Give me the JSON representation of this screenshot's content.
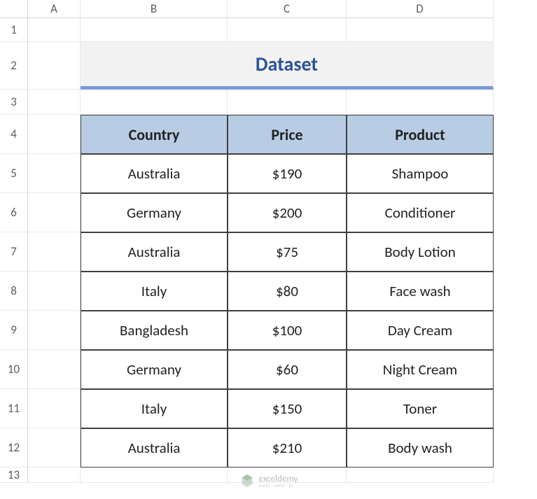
{
  "columns": [
    "A",
    "B",
    "C",
    "D"
  ],
  "rows": [
    "1",
    "2",
    "3",
    "4",
    "5",
    "6",
    "7",
    "8",
    "9",
    "10",
    "11",
    "12",
    "13"
  ],
  "title": "Dataset",
  "headers": {
    "country": "Country",
    "price": "Price",
    "product": "Product"
  },
  "data": [
    {
      "country": "Australia",
      "price": "$190",
      "product": "Shampoo"
    },
    {
      "country": "Germany",
      "price": "$200",
      "product": "Conditioner"
    },
    {
      "country": "Australia",
      "price": "$75",
      "product": "Body Lotion"
    },
    {
      "country": "Italy",
      "price": "$80",
      "product": "Face wash"
    },
    {
      "country": "Bangladesh",
      "price": "$100",
      "product": "Day Cream"
    },
    {
      "country": "Germany",
      "price": "$60",
      "product": "Night Cream"
    },
    {
      "country": "Italy",
      "price": "$150",
      "product": "Toner"
    },
    {
      "country": "Australia",
      "price": "$210",
      "product": "Body wash"
    }
  ],
  "watermark": {
    "name": "exceldemy",
    "tagline": "EXCEL · DATA · BI"
  },
  "chart_data": {
    "type": "table",
    "title": "Dataset",
    "columns": [
      "Country",
      "Price",
      "Product"
    ],
    "rows": [
      [
        "Australia",
        "$190",
        "Shampoo"
      ],
      [
        "Germany",
        "$200",
        "Conditioner"
      ],
      [
        "Australia",
        "$75",
        "Body Lotion"
      ],
      [
        "Italy",
        "$80",
        "Face wash"
      ],
      [
        "Bangladesh",
        "$100",
        "Day Cream"
      ],
      [
        "Germany",
        "$60",
        "Night Cream"
      ],
      [
        "Italy",
        "$150",
        "Toner"
      ],
      [
        "Australia",
        "$210",
        "Body wash"
      ]
    ]
  }
}
